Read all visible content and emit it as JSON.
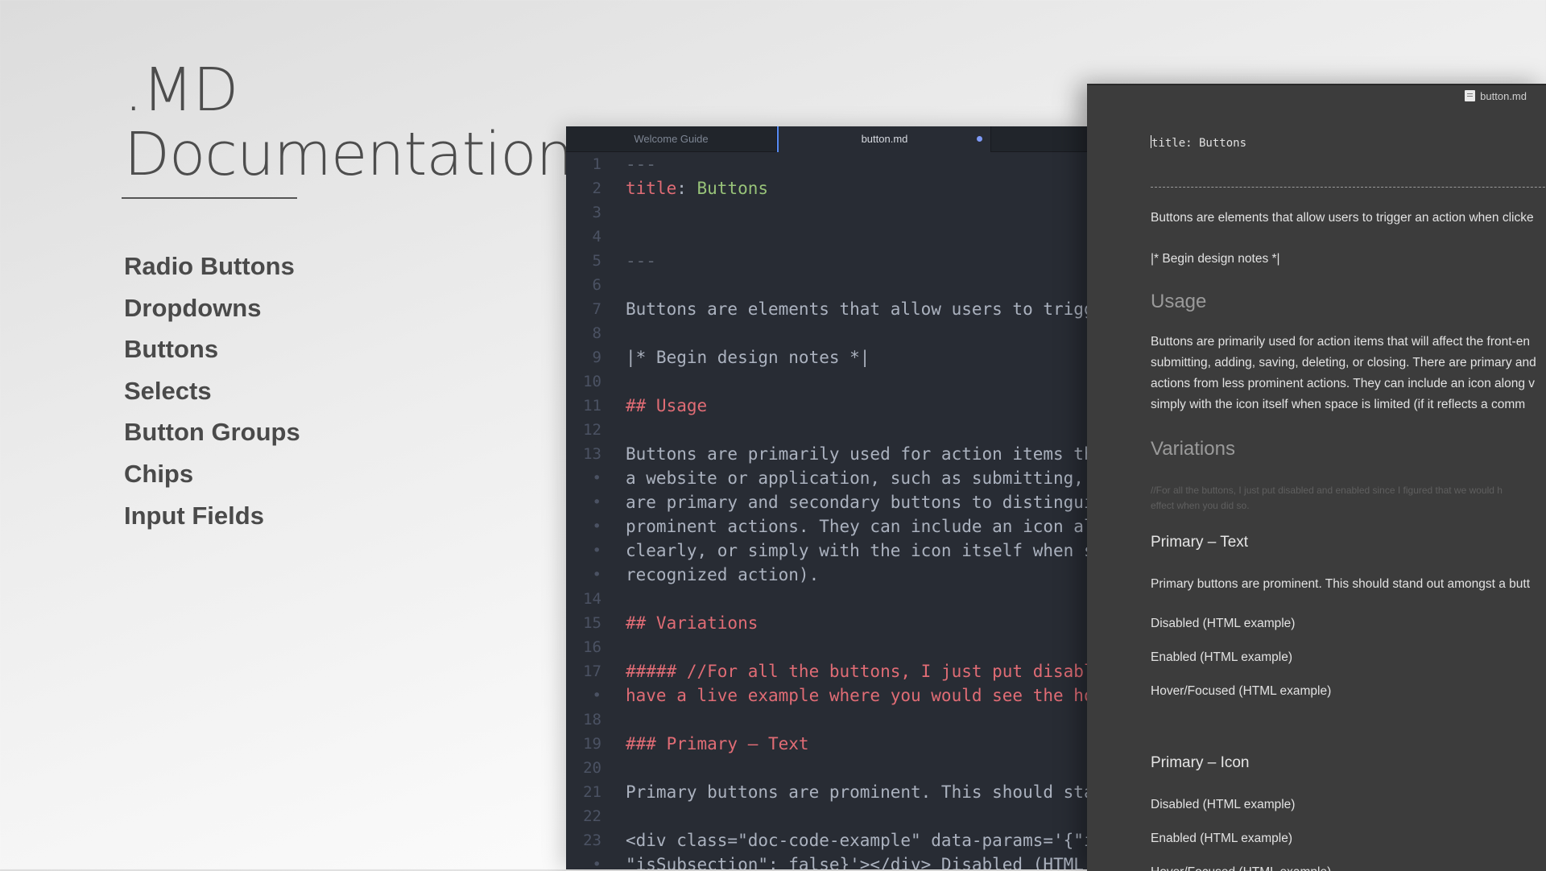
{
  "hero": {
    "title_line1": ".MD",
    "title_line2": "Documentation:"
  },
  "topics": [
    "Radio Buttons",
    "Dropdowns",
    "Buttons",
    "Selects",
    "Button Groups",
    "Chips",
    "Input Fields"
  ],
  "editor": {
    "tabs": [
      {
        "label": "Welcome Guide",
        "active": false
      },
      {
        "label": "button.md",
        "active": true,
        "modified": true
      }
    ],
    "lines": [
      {
        "n": "1",
        "text": "---"
      },
      {
        "n": "2",
        "key": "title",
        "sep": ": ",
        "value": "Buttons"
      },
      {
        "n": "3",
        "text": ""
      },
      {
        "n": "4",
        "text": ""
      },
      {
        "n": "5",
        "text": "---"
      },
      {
        "n": "6",
        "text": ""
      },
      {
        "n": "7",
        "text": "Buttons are elements that allow users to trigger"
      },
      {
        "n": "8",
        "text": ""
      },
      {
        "n": "9",
        "text": "|* Begin design notes *|"
      },
      {
        "n": "10",
        "text": ""
      },
      {
        "n": "11",
        "text": "## Usage"
      },
      {
        "n": "12",
        "text": ""
      },
      {
        "n": "13",
        "text": "Buttons are primarily used for action items that"
      },
      {
        "n": "•",
        "text": "a website or application, such as submitting, ac"
      },
      {
        "n": "•",
        "text": "are primary and secondary buttons to distinguish"
      },
      {
        "n": "•",
        "text": "prominent actions. They can include an icon alor"
      },
      {
        "n": "•",
        "text": "clearly, or simply with the icon itself when spa"
      },
      {
        "n": "•",
        "text": "recognized action)."
      },
      {
        "n": "14",
        "text": ""
      },
      {
        "n": "15",
        "text": "## Variations"
      },
      {
        "n": "16",
        "text": ""
      },
      {
        "n": "17",
        "text": "##### //For all the buttons, I just put disabled"
      },
      {
        "n": "•",
        "text": "have a live example where you would see the hove"
      },
      {
        "n": "18",
        "text": ""
      },
      {
        "n": "19",
        "text": "### Primary – Text"
      },
      {
        "n": "20",
        "text": ""
      },
      {
        "n": "21",
        "text": "Primary buttons are prominent. This should stand"
      },
      {
        "n": "22",
        "text": ""
      },
      {
        "n": "23",
        "text": "<div class=\"doc-code-example\" data-params='{\"isA"
      },
      {
        "n": "•",
        "text": "\"isSubsection\": false}'></div> Disabled (HTML ex"
      }
    ]
  },
  "preview": {
    "window_title": "button.md",
    "frontmatter": "title: Buttons",
    "intro": "Buttons are elements that allow users to trigger an action when clicke",
    "design_notes": "|* Begin design notes *|",
    "usage_heading": "Usage",
    "usage_lines": [
      "Buttons are primarily used for action items that will affect the front-en",
      "submitting, adding, saving, deleting, or closing. There are primary and",
      "actions from less prominent actions. They can include an icon along v",
      "simply with the icon itself when space is limited (if it reflects a comm"
    ],
    "variations_heading": "Variations",
    "variations_note_lines": [
      "//For all the buttons, I just put disabled and enabled since I figured that we would h",
      "effect when you did so."
    ],
    "primary_text_heading": "Primary – Text",
    "primary_text_desc": "Primary buttons are prominent. This should stand out amongst a butt",
    "primary_text_examples": [
      "Disabled (HTML example)",
      "Enabled (HTML example)",
      "Hover/Focused (HTML example)"
    ],
    "primary_icon_heading": "Primary – Icon",
    "primary_icon_examples": [
      "Disabled (HTML example)",
      "Enabled (HTML example)",
      "Hover/Focused (HTML example)"
    ]
  }
}
